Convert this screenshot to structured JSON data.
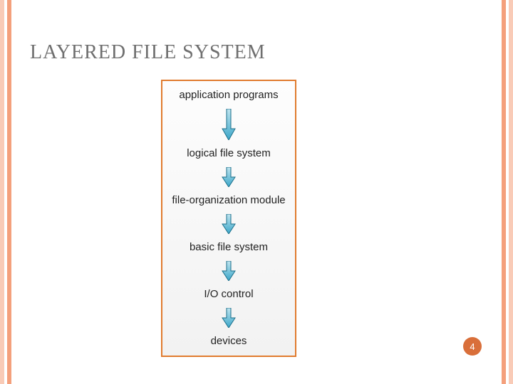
{
  "title": "LAYERED FILE SYSTEM",
  "layers": [
    "application programs",
    "logical file system",
    "file-organization module",
    "basic file system",
    "I/O control",
    "devices"
  ],
  "page_number": "4",
  "colors": {
    "accent": "#d96f3a",
    "box_border": "#e07b2e",
    "arrow_fill": "#3aa6c9",
    "arrow_stroke": "#1b6f8a"
  },
  "chart_data": {
    "type": "diagram",
    "title": "Layered File System",
    "direction": "top-to-bottom",
    "nodes": [
      "application programs",
      "logical file system",
      "file-organization module",
      "basic file system",
      "I/O control",
      "devices"
    ],
    "edges": [
      [
        "application programs",
        "logical file system"
      ],
      [
        "logical file system",
        "file-organization module"
      ],
      [
        "file-organization module",
        "basic file system"
      ],
      [
        "basic file system",
        "I/O control"
      ],
      [
        "I/O control",
        "devices"
      ]
    ]
  }
}
